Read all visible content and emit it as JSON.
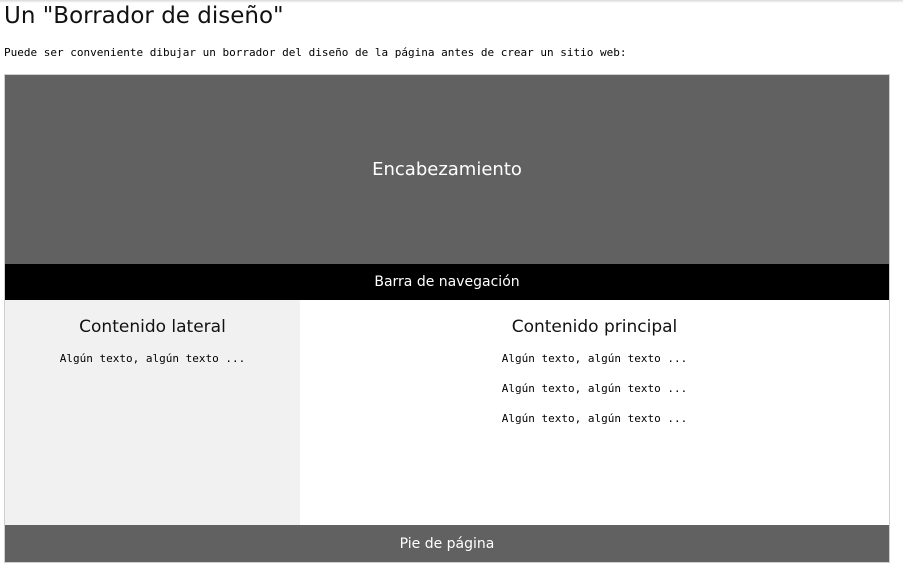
{
  "page": {
    "title": "Un \"Borrador de diseño\"",
    "intro": "Puede ser conveniente dibujar un borrador del diseño de la página antes de crear un sitio web:"
  },
  "mockup": {
    "header": "Encabezamiento",
    "navbar": "Barra de navegación",
    "side": {
      "title": "Contenido lateral",
      "texts": [
        "Algún texto, algún texto ..."
      ]
    },
    "main": {
      "title": "Contenido principal",
      "texts": [
        "Algún texto, algún texto ...",
        "Algún texto, algún texto ...",
        "Algún texto, algún texto ..."
      ]
    },
    "footer": "Pie de página"
  },
  "colors": {
    "header_bg": "#616161",
    "navbar_bg": "#000000",
    "side_bg": "#f1f1f1",
    "footer_bg": "#616161",
    "text_on_dark": "#ffffff"
  }
}
